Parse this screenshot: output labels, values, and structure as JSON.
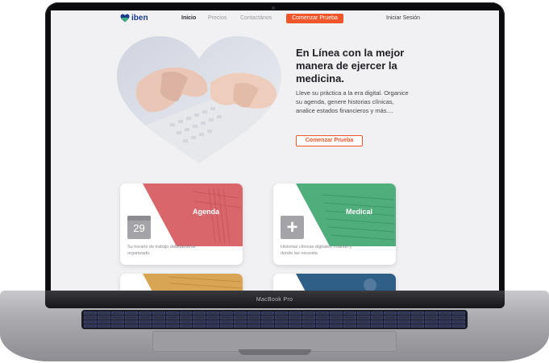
{
  "device": {
    "brand_label": "MacBook Pro"
  },
  "nav": {
    "logo_text": "iben",
    "links": [
      {
        "label": "Inicio",
        "active": true
      },
      {
        "label": "Precios",
        "active": false
      },
      {
        "label": "Contactános",
        "active": false
      }
    ],
    "cta_label": "Comenzar Prueba",
    "login_label": "Iniciar Sesión"
  },
  "hero": {
    "title": "En Línea con la mejor manera de ejercer la medicina.",
    "description": "Lleve su práctica a la era digital. Organice su agenda, genere historias clínicas, analice estados financieros y más....",
    "cta_label": "Comenzar Prueba"
  },
  "cards": [
    {
      "title": "Agenda",
      "icon": "calendar-icon",
      "icon_text": "29",
      "description": "Su horario de trabajo debidamente organizado.",
      "color": "#d9666a"
    },
    {
      "title": "Medical",
      "icon": "plus-icon",
      "icon_text": "+",
      "description": "Historias clínicas digitales, cuando y donde las necesite.",
      "color": "#4fae7c"
    },
    {
      "title": "",
      "icon": "",
      "icon_text": "",
      "description": "",
      "color": "#d8a554"
    },
    {
      "title": "",
      "icon": "",
      "icon_text": "",
      "description": "",
      "color": "#2f5e86"
    }
  ],
  "colors": {
    "accent": "#f0562a",
    "logo_blue": "#1a3a8a",
    "logo_green": "#3bb27a"
  }
}
